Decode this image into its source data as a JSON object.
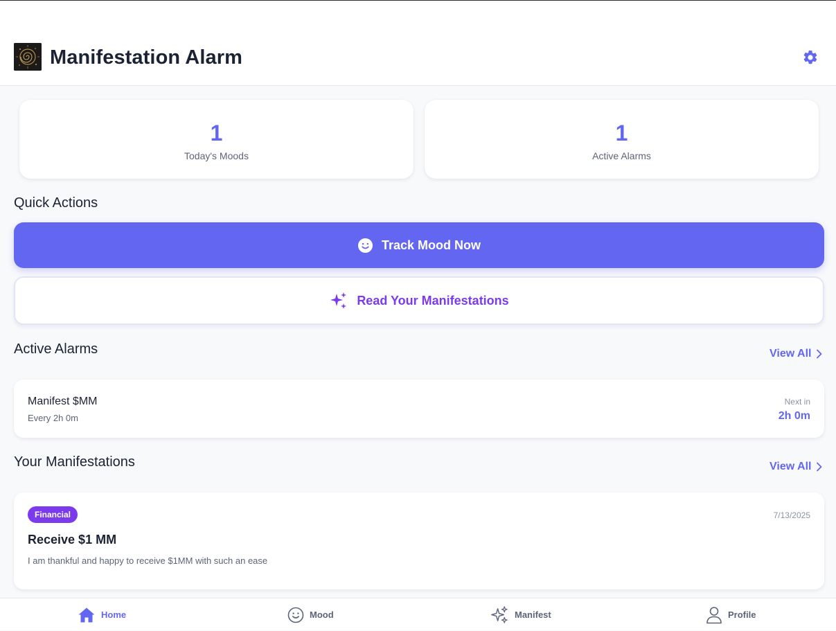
{
  "header": {
    "title": "Manifestation Alarm",
    "logo_icon": "galaxy-logo-icon",
    "settings_icon": "gear-icon"
  },
  "stats": [
    {
      "value": "1",
      "label": "Today's Moods"
    },
    {
      "value": "1",
      "label": "Active Alarms"
    }
  ],
  "quick_actions": {
    "title": "Quick Actions",
    "track_mood": {
      "label": "Track Mood Now",
      "icon": "smiley-icon"
    },
    "read_manifestations": {
      "label": "Read Your Manifestations",
      "icon": "sparkles-icon"
    }
  },
  "active_alarms": {
    "title": "Active Alarms",
    "view_all": "View All",
    "items": [
      {
        "name": "Manifest $MM",
        "frequency": "Every 2h 0m",
        "next_label": "Next in",
        "next_value": "2h 0m"
      }
    ]
  },
  "manifestations": {
    "title": "Your Manifestations",
    "view_all": "View All",
    "items": [
      {
        "category": "Financial",
        "date": "7/13/2025",
        "title": "Receive $1 MM",
        "text": "I am thankful and happy to receive $1MM with such an ease"
      }
    ]
  },
  "nav": {
    "items": [
      {
        "label": "Home",
        "icon": "home-icon",
        "active": true
      },
      {
        "label": "Mood",
        "icon": "smiley-icon",
        "active": false
      },
      {
        "label": "Manifest",
        "icon": "sparkles-icon",
        "active": false
      },
      {
        "label": "Profile",
        "icon": "user-icon",
        "active": false
      }
    ]
  },
  "colors": {
    "primary": "#6366f1",
    "accent_purple": "#7c3aed",
    "text_dark": "#1a2233",
    "text_muted": "#5b6477",
    "background": "#f8f9fb"
  }
}
